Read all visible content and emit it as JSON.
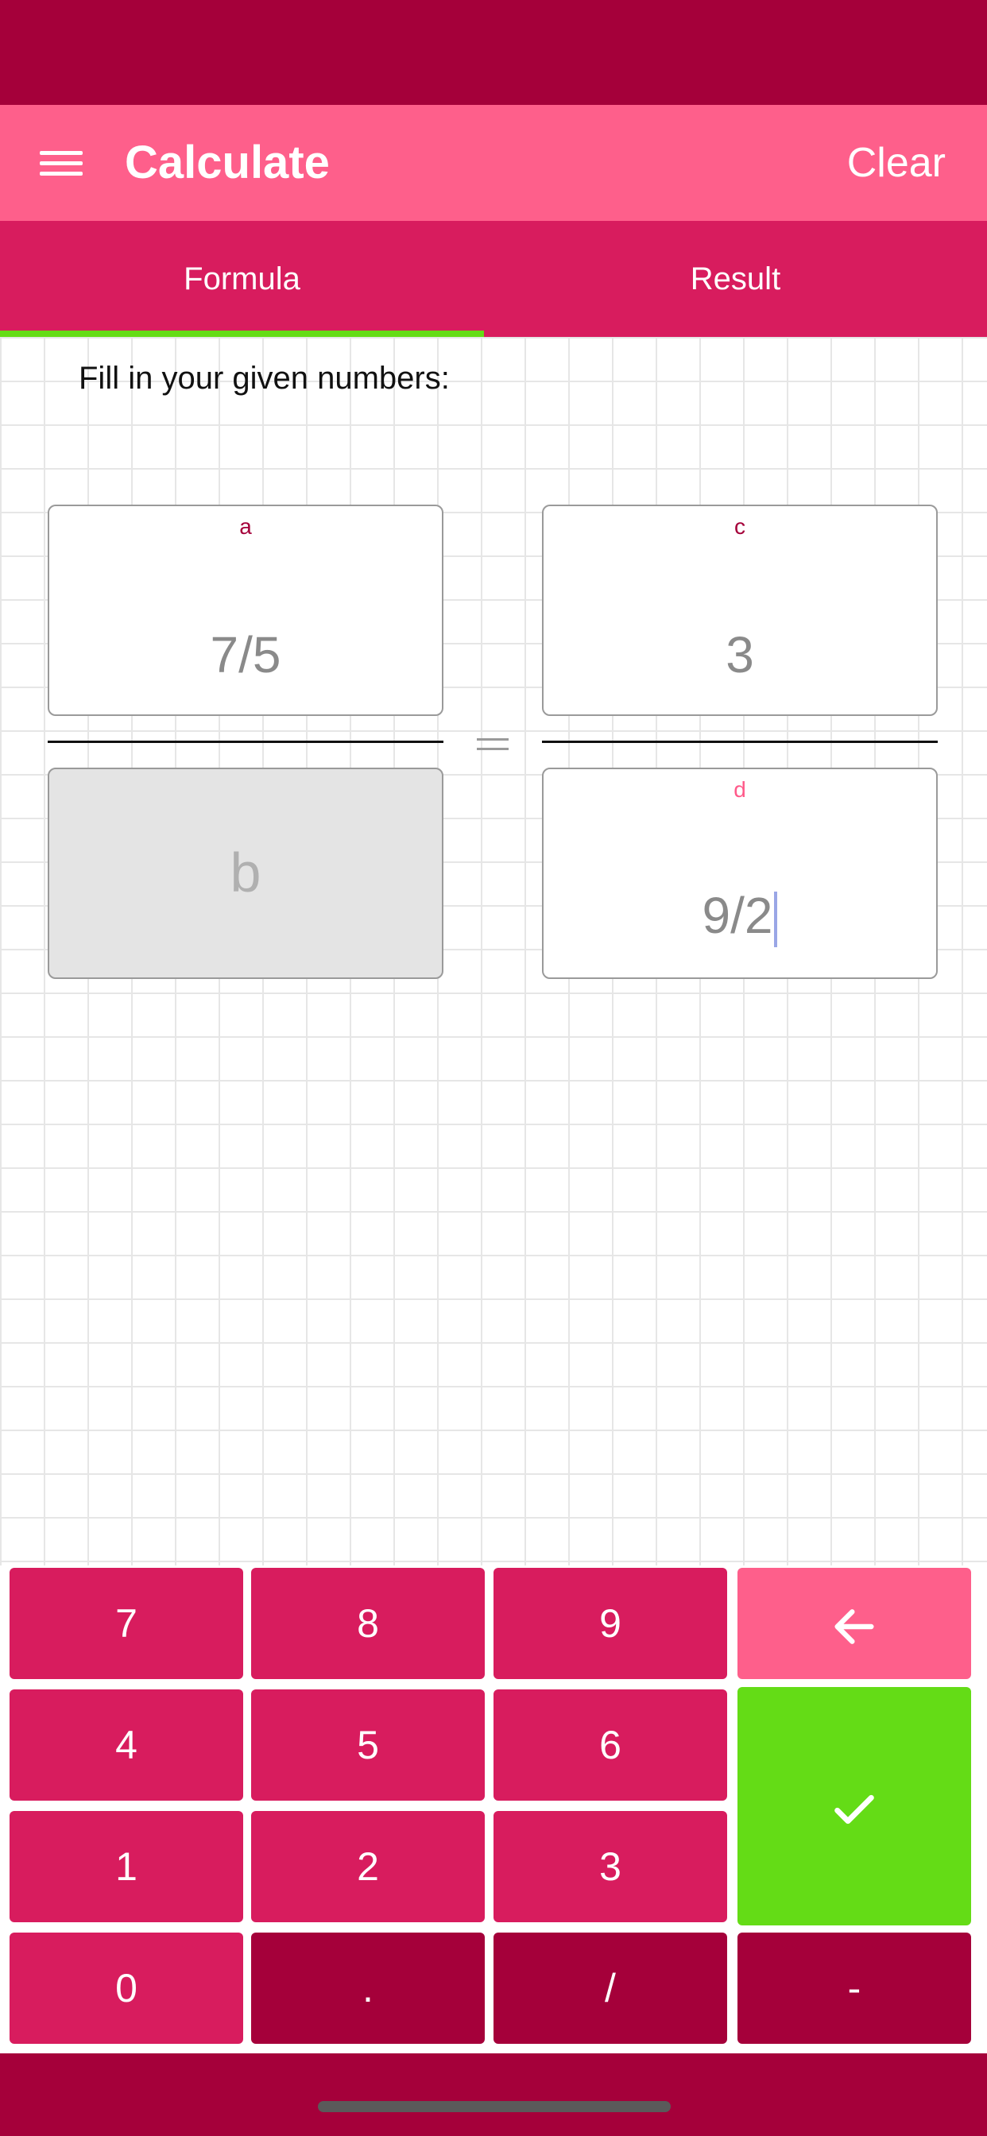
{
  "app_bar": {
    "title": "Calculate",
    "clear_label": "Clear"
  },
  "tabs": [
    {
      "label": "Formula",
      "active": true
    },
    {
      "label": "Result",
      "active": false
    }
  ],
  "instruction": "Fill in your given numbers:",
  "fields": {
    "a": {
      "label": "a",
      "value": "7/5"
    },
    "b": {
      "placeholder": "b"
    },
    "c": {
      "label": "c",
      "value": "3"
    },
    "d": {
      "label": "d",
      "value": "9/2"
    }
  },
  "keypad": {
    "digits": [
      "7",
      "8",
      "9",
      "4",
      "5",
      "6",
      "1",
      "2",
      "3",
      "0"
    ],
    "dot": ".",
    "slash": "/",
    "minus": "-",
    "backspace_icon": "arrow-left-icon",
    "enter_icon": "check-icon"
  },
  "colors": {
    "status_bar": "#a5003a",
    "app_bar": "#fe5f8b",
    "tabs": "#d81c5e",
    "tab_indicator": "#64dc16",
    "key_primary": "#d81c5e",
    "key_dark": "#a5003a",
    "key_backspace": "#fe5f8b",
    "key_enter": "#64dc16"
  }
}
